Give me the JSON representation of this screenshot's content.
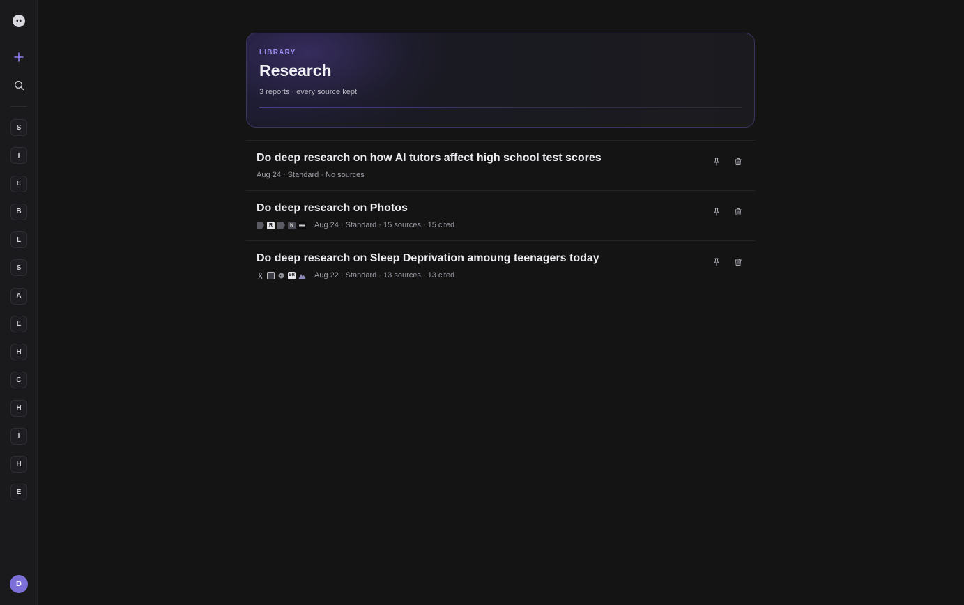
{
  "sidebar": {
    "logo_icon": "ghost-logo-icon",
    "new_icon": "plus-icon",
    "search_icon": "search-icon",
    "items": [
      "S",
      "I",
      "E",
      "B",
      "L",
      "S",
      "A",
      "E",
      "H",
      "C",
      "H",
      "I",
      "H",
      "E"
    ],
    "avatar_initial": "D",
    "accent": "#8b7ff0",
    "avatar_color": "#7c6fd8"
  },
  "header": {
    "eyebrow": "LIBRARY",
    "title": "Research",
    "subtitle": "3 reports · every source kept"
  },
  "reports": [
    {
      "title": "Do deep research on how AI tutors affect high school test scores",
      "meta": "Aug 24 · Standard · No sources",
      "source_favicons": []
    },
    {
      "title": "Do deep research on Photos",
      "meta": "Aug 24 · Standard · 15 sources · 15 cited",
      "source_favicons": [
        "grey-shape-icon",
        "r-letter-icon",
        "grey-shape-icon",
        "n-letter-icon",
        "dash-logo-icon"
      ]
    },
    {
      "title": "Do deep research on Sleep Deprivation amoung teenagers today",
      "meta": "Aug 22 · Standard · 13 sources · 13 cited",
      "source_favicons": [
        "sleep-figure-icon",
        "grid-logo-icon",
        "head-profile-icon",
        "br-logo-icon",
        "mountain-icon"
      ]
    }
  ],
  "row_actions": {
    "pin_icon": "pin-icon",
    "delete_icon": "trash-icon"
  }
}
